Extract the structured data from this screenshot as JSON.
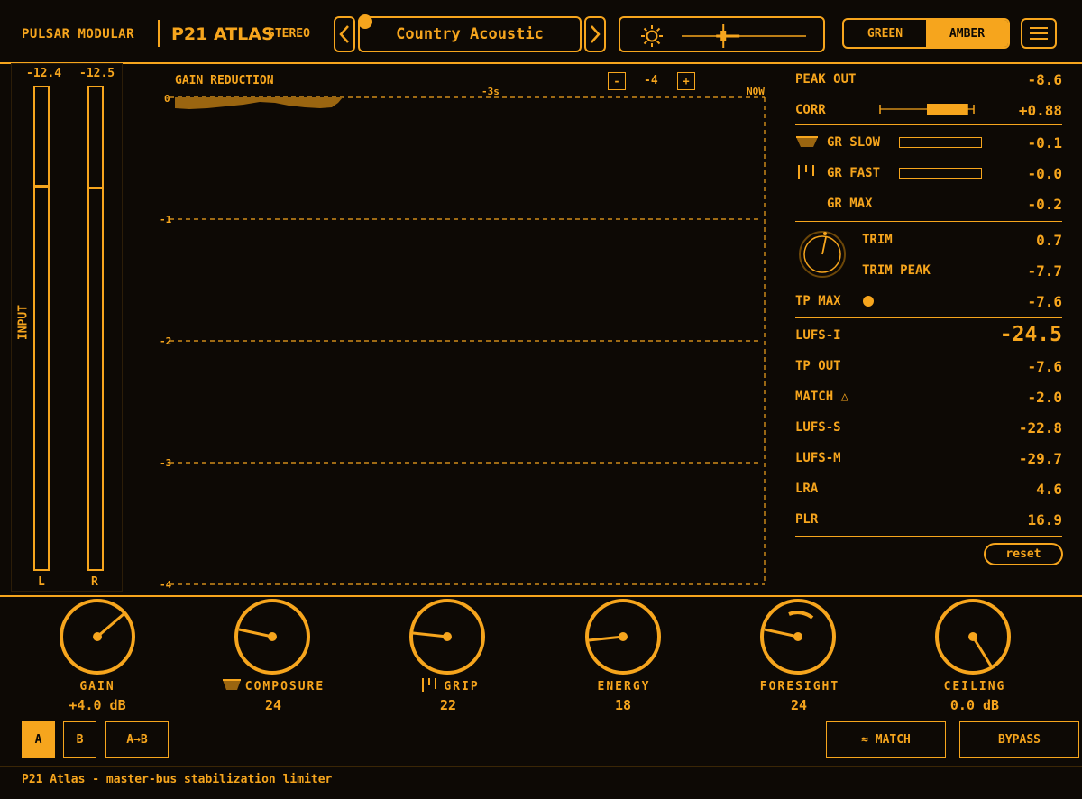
{
  "header": {
    "brand": "PULSAR MODULAR",
    "product": "P21 ATLAS",
    "channel_mode": "STEREO",
    "preset": "Country Acoustic",
    "brightness_level": 0.33,
    "theme_options": [
      "GREEN",
      "AMBER"
    ],
    "theme_selected": "AMBER"
  },
  "input": {
    "label": "INPUT",
    "left_value": "-12.4",
    "right_value": "-12.5",
    "left_label": "L",
    "right_label": "R"
  },
  "gr_graph": {
    "title": "GAIN REDUCTION",
    "zoom_minus": "-",
    "zoom_value": "-4",
    "zoom_plus": "+",
    "time_marker": "-3s",
    "now_label": "NOW",
    "y_labels": [
      "0",
      "-1",
      "-2",
      "-3",
      "-4"
    ]
  },
  "readouts": {
    "peak_out": {
      "label": "PEAK OUT",
      "value": "-8.6"
    },
    "corr": {
      "label": "CORR",
      "value": "+0.88",
      "level": 0.88
    },
    "gr_slow": {
      "label": "GR SLOW",
      "value": "-0.1"
    },
    "gr_fast": {
      "label": "GR FAST",
      "value": "-0.0"
    },
    "gr_max": {
      "label": "GR MAX",
      "value": "-0.2"
    },
    "trim": {
      "label": "TRIM",
      "value": "0.7"
    },
    "trim_peak": {
      "label": "TRIM PEAK",
      "value": "-7.7"
    },
    "tp_max": {
      "label": "TP MAX",
      "value": "-7.6"
    },
    "lufs_i": {
      "label": "LUFS-I",
      "value": "-24.5"
    },
    "tp_out": {
      "label": "TP OUT",
      "value": "-7.6"
    },
    "match": {
      "label": "MATCH △",
      "value": "-2.0"
    },
    "lufs_s": {
      "label": "LUFS-S",
      "value": "-22.8"
    },
    "lufs_m": {
      "label": "LUFS-M",
      "value": "-29.7"
    },
    "lra": {
      "label": "LRA",
      "value": "4.6"
    },
    "plr": {
      "label": "PLR",
      "value": "16.9"
    },
    "reset_label": "reset"
  },
  "knobs": [
    {
      "label": "GAIN",
      "value": "+4.0 dB"
    },
    {
      "label": "COMPOSURE",
      "value": "24"
    },
    {
      "label": "GRIP",
      "value": "22"
    },
    {
      "label": "ENERGY",
      "value": "18"
    },
    {
      "label": "FORESIGHT",
      "value": "24"
    },
    {
      "label": "CEILING",
      "value": "0.0 dB"
    }
  ],
  "bottom": {
    "slot_a": "A",
    "slot_b": "B",
    "copy": "A→B",
    "match_btn": "≈ MATCH",
    "bypass_btn": "BYPASS",
    "footer": "P21 Atlas - master-bus stabilization limiter"
  },
  "colors": {
    "accent": "#f6a51d",
    "background": "#0d0905",
    "gr_fill": "#9a6510"
  }
}
